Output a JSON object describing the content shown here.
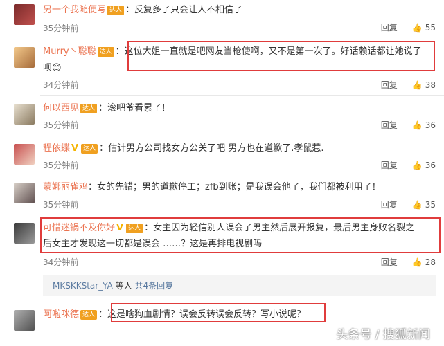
{
  "colors": {
    "username": "#eb7350",
    "highlight_box": "#e03c3c",
    "badge": "#f0a020"
  },
  "badge_label": "达人",
  "reply_label": "回复",
  "comments": [
    {
      "user": "另一个我随便写",
      "text": "：反复多了只会让人不相信了",
      "time": "35分钟前",
      "likes": "55"
    },
    {
      "user": "Murry丶聪聪",
      "text": "：这位大姐一直就是吧网友当枪使啊，又不是第一次了。好话赖话都让她说了",
      "text2": "呗",
      "time": "34分钟前",
      "likes": "38"
    },
    {
      "user": "何以西见",
      "text": "：滚吧爷看累了！",
      "time": "35分钟前",
      "likes": "36"
    },
    {
      "user": "程依蝶",
      "text": "：估计男方公司找女方公关了吧 男方也在道歉了.孝鼠惹.",
      "time": "35分钟前",
      "likes": "36"
    },
    {
      "user": "蒙娜丽雀鸡",
      "text": "：女的先错；男的道歉停工；zfb到账；是我误会他了，我们都被利用了！",
      "time": "35分钟前",
      "likes": "35"
    },
    {
      "user": "可惜迷锅不及你好",
      "text": "：女主因为轻信别人误会了男主然后展开报复，最后男主身败名裂之",
      "text2": "后女主才发现这一切都是误会 ……？这是再排电视剧吗",
      "time": "34分钟前",
      "likes": "28"
    },
    {
      "user": "阿啦咪德",
      "text": "：这是啥狗血剧情？误会反转误会反转？写小说呢？"
    }
  ],
  "more_replies": {
    "user": "MKSKKStar_YA",
    "suffix": " 等人",
    "count_text": "共4条回复"
  },
  "watermark": "头条号 / 搜狐新闻"
}
